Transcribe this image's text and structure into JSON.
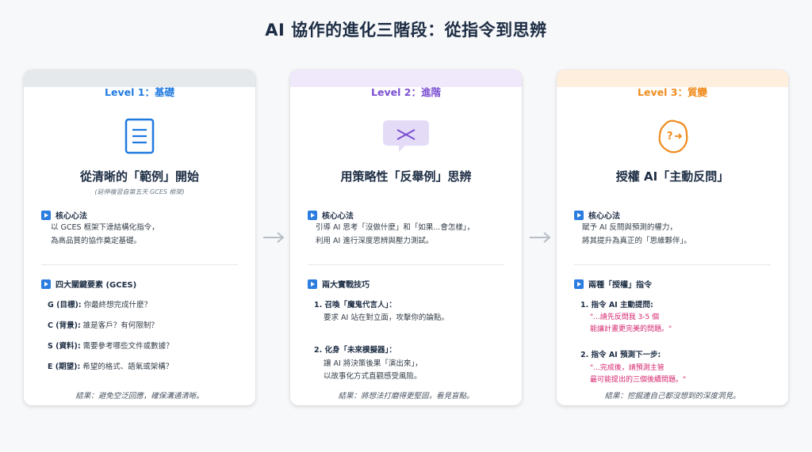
{
  "title": "AI 協作的進化三階段：從指令到思辨",
  "cards": [
    {
      "level": "Level 1：基礎",
      "icon": "document-icon",
      "title": "從清晰的「範例」開始",
      "subtitle": "(延伸複習自第五天 GCES 框架)",
      "core_label": "核心心法",
      "core_lines": [
        "以 GCES 框架下達結構化指令，",
        "為高品質的協作奠定基礎。"
      ],
      "section_label": "四大關鍵要素 (GCES)",
      "items": [
        {
          "key": "G (目標):",
          "text": " 你最終想完成什麼？"
        },
        {
          "key": "C (背景):",
          "text": " 誰是客戶？有何限制？"
        },
        {
          "key": "S (資料):",
          "text": " 需要參考哪些文件或數據？"
        },
        {
          "key": "E (期望):",
          "text": " 希望的格式、語氣或架構？"
        }
      ],
      "footer": "結果：避免空泛回應，確保溝通清晰。"
    },
    {
      "level": "Level 2：進階",
      "icon": "chat-bubble-icon",
      "title": "用策略性「反舉例」思辨",
      "core_label": "核心心法",
      "core_lines": [
        "引導 AI 思考「沒做什麼」和「如果...會怎樣」，",
        "利用 AI 進行深度思辨與壓力測試。"
      ],
      "section_label": "兩大實戰技巧",
      "steps": [
        {
          "title": "1. 召喚「魔鬼代言人」：",
          "lines": [
            "要求 AI 站在對立面，攻擊你的論點。"
          ]
        },
        {
          "title": "2. 化身「未來模擬器」：",
          "lines": [
            "讓 AI 將決策後果「演出來」，",
            "以故事化方式直觀感受風險。"
          ]
        }
      ],
      "footer": "結果：將想法打磨得更堅固，看見盲點。"
    },
    {
      "level": "Level 3：質變",
      "icon": "thought-question-icon",
      "title": "授權 AI「主動反問」",
      "core_label": "核心心法",
      "core_lines": [
        "賦予 AI 反問與預測的權力，",
        "將其提升為真正的「思維夥伴」。"
      ],
      "section_label": "兩種「授權」指令",
      "steps": [
        {
          "title": "1. 指令 AI 主動提問:",
          "quote": [
            "\"...請先反問我 3-5 個",
            "能讓計畫更完美的問題。\""
          ]
        },
        {
          "title": "2. 指令 AI 預測下一步:",
          "quote": [
            "\"...完成後，請預測主管",
            "最可能提出的三個後續問題。\""
          ]
        }
      ],
      "footer": "結果：挖掘連自己都沒想到的深度洞見。"
    }
  ],
  "colors": {
    "level1": "#1f7ae0",
    "level2": "#7a4fd0",
    "level3": "#f08b1d",
    "quote": "#d6246e"
  }
}
